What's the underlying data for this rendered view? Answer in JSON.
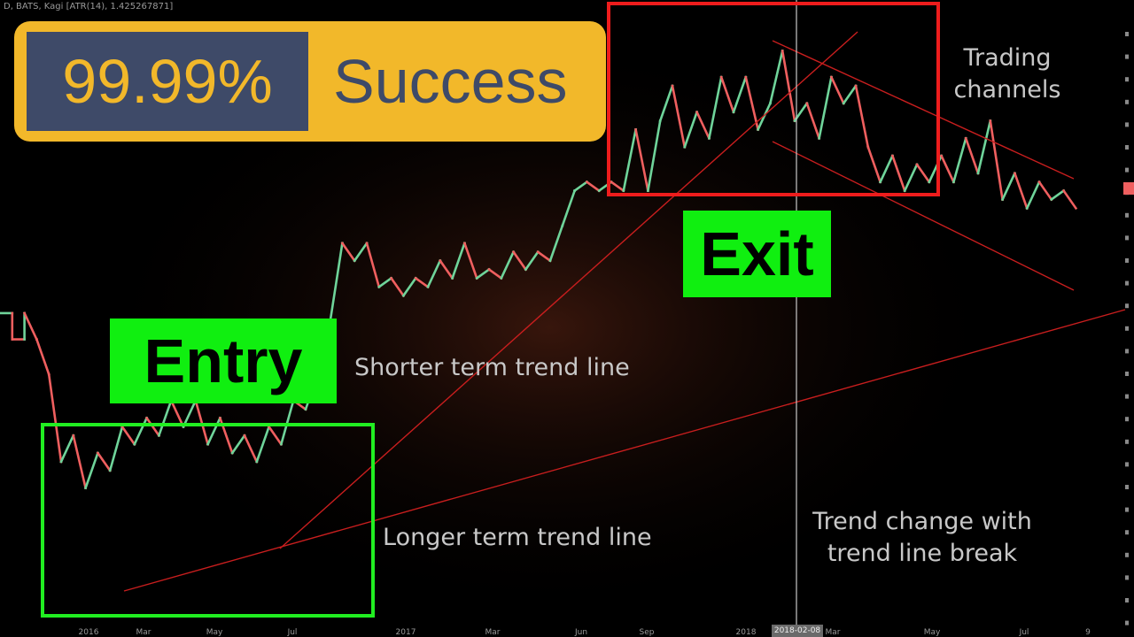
{
  "header": {
    "text": "D, BATS, Kagi [ATR(14), 1.425267871]"
  },
  "banner": {
    "percent": "99.99%",
    "word": "Success"
  },
  "labels": {
    "entry": "Entry",
    "exit": "Exit",
    "shorter": "Shorter term trend line",
    "longer": "Longer term trend line",
    "channels_line1": "Trading",
    "channels_line2": "channels",
    "change_line1": "Trend change with",
    "change_line2": "trend line break"
  },
  "crosshair_date": "2018-02-08",
  "colors": {
    "up": "#6fd49a",
    "down": "#ef5f5f",
    "trendline": "#c81e1e",
    "entry_box": "#21ee21",
    "exit_box": "#ee1c1c",
    "badge_bg": "#f2b82a",
    "badge_dark": "#3e4a68"
  },
  "chart_data": {
    "type": "line",
    "subtype": "kagi",
    "x_ticks": [
      "2016",
      "Mar",
      "May",
      "Jul",
      "2017",
      "Mar",
      "Jun",
      "Sep",
      "2018",
      "Mar",
      "May",
      "Jul",
      "9"
    ],
    "y_tick_count": 27,
    "kagi_levels": [
      33,
      33,
      30,
      30,
      33,
      30,
      30,
      26,
      26,
      16,
      16,
      19,
      19,
      13,
      13,
      17,
      17,
      15,
      15,
      20,
      20,
      18,
      18,
      21,
      21,
      19,
      19,
      23,
      23,
      20,
      20,
      23,
      23,
      18,
      18,
      21,
      21,
      17,
      17,
      19,
      19,
      16,
      16,
      20,
      20,
      18,
      18,
      23,
      23,
      22,
      22,
      26,
      26,
      32,
      32,
      41,
      41,
      39,
      39,
      41,
      41,
      36,
      36,
      37,
      37,
      35,
      35,
      37,
      37,
      36,
      36,
      39,
      39,
      37,
      37,
      41,
      41,
      37,
      37,
      38,
      38,
      37,
      37,
      40,
      40,
      38,
      38,
      40,
      40,
      39,
      39,
      43,
      43,
      47,
      47,
      48,
      48,
      47,
      47,
      48,
      48,
      47,
      47,
      54,
      54,
      47,
      47,
      55,
      55,
      59,
      59,
      52,
      52,
      56,
      56,
      53,
      53,
      60,
      60,
      56,
      56,
      60,
      60,
      54,
      54,
      57,
      57,
      63,
      63,
      55,
      55,
      57,
      57,
      53,
      53,
      60,
      60,
      57,
      57,
      59,
      59,
      52,
      52,
      48,
      48,
      51,
      51,
      47,
      47,
      50,
      50,
      48,
      48,
      51,
      51,
      48,
      48,
      53,
      53,
      49,
      49,
      55,
      55,
      46,
      46,
      49,
      49,
      45,
      45,
      48,
      48,
      46,
      46,
      47,
      47,
      45
    ],
    "ylim": [
      0,
      67
    ],
    "grid": false,
    "legend": "none"
  }
}
